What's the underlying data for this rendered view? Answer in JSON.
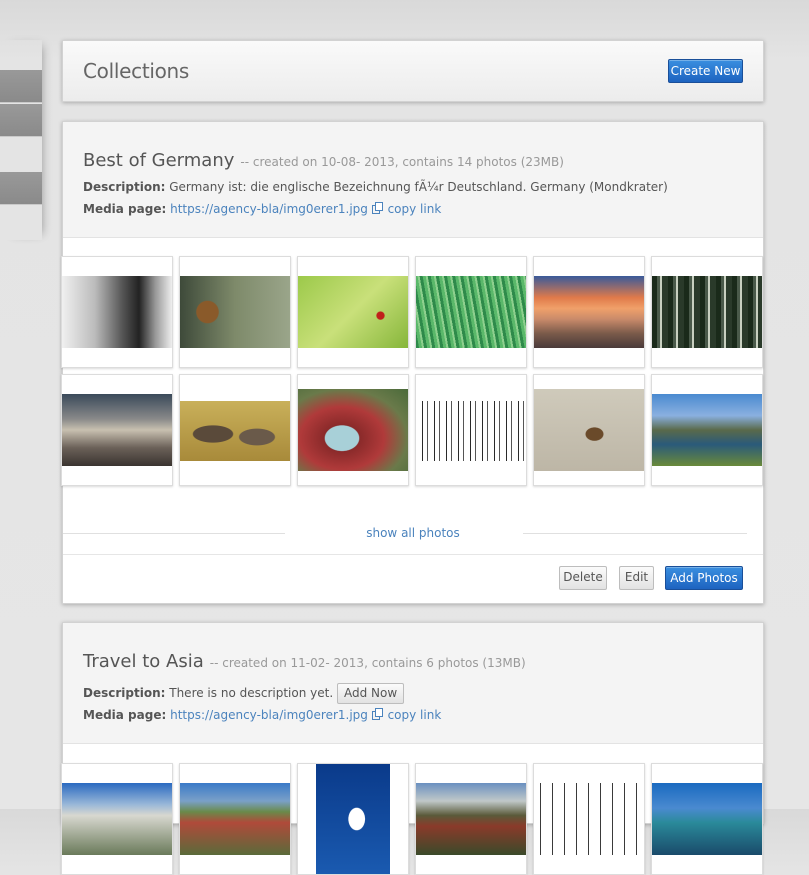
{
  "header": {
    "title": "Collections",
    "create_label": "Create New"
  },
  "collections": [
    {
      "title": "Best of Germany",
      "meta": "-- created on 10-08- 2013, contains 14 photos (23MB)",
      "description_label": "Description:",
      "description": "Germany ist: die englische Bezeichnung fÃ¼r Deutschland. Germany (Mondkrater)",
      "media_label": "Media page:",
      "media_url": "https://agency-bla/img0erer1.jpg",
      "copy_label": "copy link",
      "show_all_label": "show all photos",
      "delete_label": "Delete",
      "edit_label": "Edit",
      "add_photos_label": "Add Photos"
    },
    {
      "title": "Travel to Asia",
      "meta": "-- created on 11-02- 2013, contains 6 photos (13MB)",
      "description_label": "Description:",
      "description": "There is no description yet.",
      "add_now_label": "Add Now",
      "media_label": "Media page:",
      "media_url": "https://agency-bla/img0erer1.jpg",
      "copy_label": "copy link"
    }
  ],
  "colors": {
    "accent_blue": "#2a74d0",
    "link": "#4b83bd"
  },
  "icons": {
    "copy": "copy-icon"
  }
}
